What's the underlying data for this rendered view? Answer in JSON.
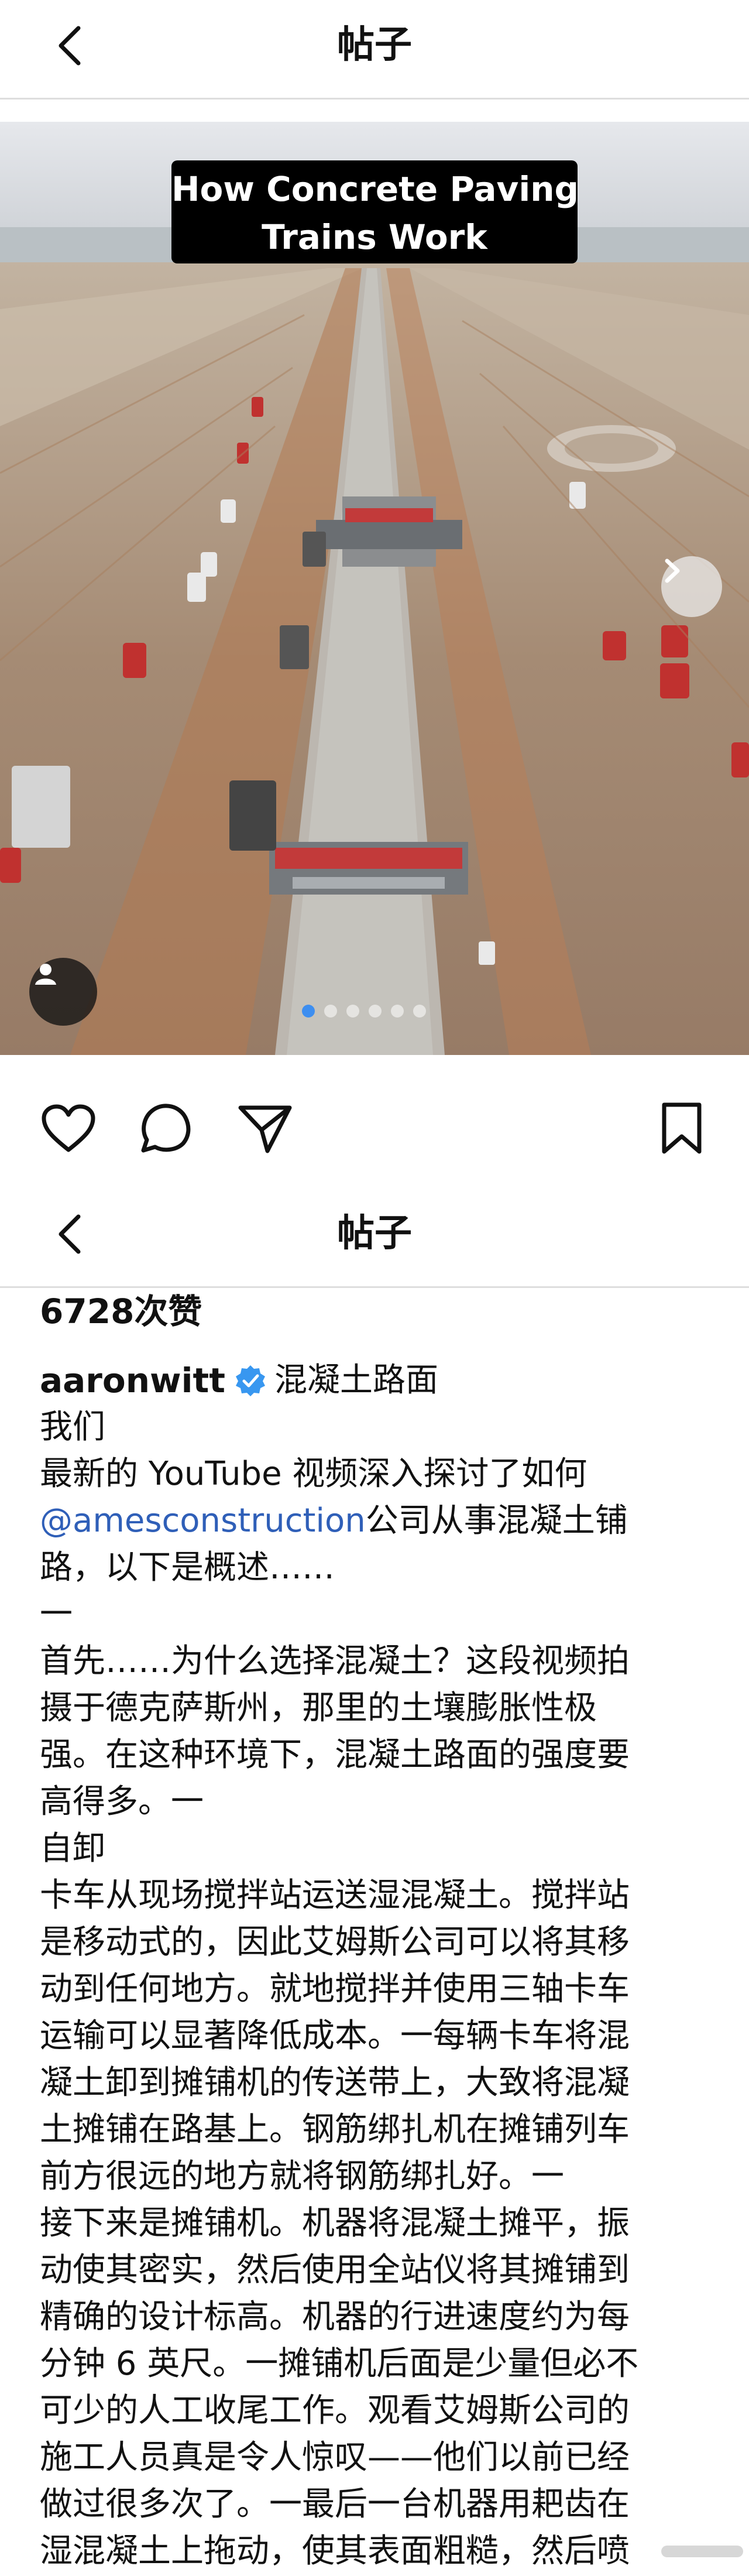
{
  "header": {
    "title": "帖子",
    "back_icon": "chevron-left-icon"
  },
  "header_repeat": {
    "title": "帖子",
    "back_icon": "chevron-left-icon"
  },
  "media": {
    "overlay_lines": [
      "How Concrete Paving",
      "Trains Work"
    ],
    "carousel": {
      "count": 6,
      "active_index": 0
    },
    "next_icon": "chevron-right-icon",
    "tag_icon": "person-icon"
  },
  "actions": {
    "like_icon": "heart-icon",
    "comment_icon": "comment-bubble-icon",
    "share_icon": "send-icon",
    "save_icon": "bookmark-icon"
  },
  "post": {
    "likes": "6728次赞",
    "author": "aaronwitt",
    "verified_icon": "verified-badge-icon",
    "title": "混凝土路面",
    "caption_before_mention": "我们\n最新的 YouTube 视频深入探讨了如何\n",
    "mention": "@amesconstruction",
    "caption_after_mention": "公司从事混凝土铺\n路，以下是概述……\n一\n首先……为什么选择混凝土？这段视频拍\n摄于德克萨斯州，那里的土壤膨胀性极\n强。在这种环境下，混凝土路面的强度要\n高得多。一\n自卸\n卡车从现场搅拌站运送湿混凝土。搅拌站\n是移动式的，因此艾姆斯公司可以将其移\n动到任何地方。就地搅拌并使用三轴卡车\n运输可以显著降低成本。一每辆卡车将混\n凝土卸到摊铺机的传送带上，大致将混凝\n土摊铺在路基上。钢筋绑扎机在摊铺列车\n前方很远的地方就将钢筋绑扎好。一\n接下来是摊铺机。机器将混凝土摊平，振\n动使其密实，然后使用全站仪将其摊铺到\n精确的设计标高。机器的行进速度约为每\n分钟 6 英尺。一摊铺机后面是少量但必不\n可少的人工收尾工作。观看艾姆斯公司的\n施工人员真是令人惊叹——他们以前已经\n做过很多次了。一最后一台机器用耙齿在\n湿混凝土上拖动，使其表面粗糙，然后喷\n洒养护剂。"
  },
  "colors": {
    "accent": "#3d8ef0",
    "mention": "#2f5fb8",
    "verified": "#3897f0"
  }
}
